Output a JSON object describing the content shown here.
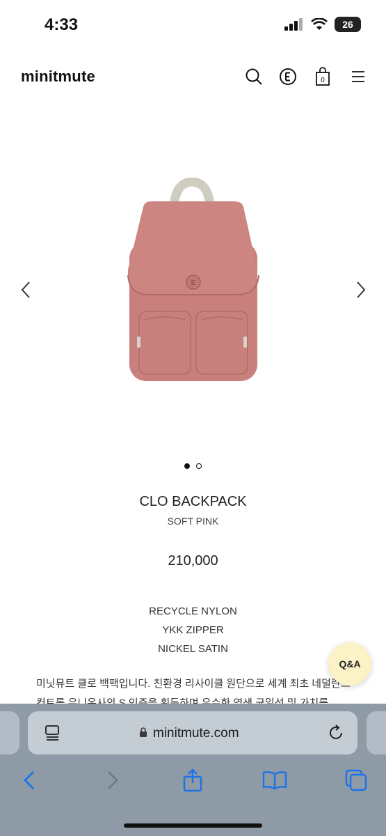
{
  "status_bar": {
    "time": "4:33",
    "battery": "26"
  },
  "header": {
    "logo": "minitmute",
    "icons": [
      "search-icon",
      "e-brand-icon",
      "cart-icon",
      "menu-icon"
    ],
    "cart_count": "0"
  },
  "carousel": {
    "image": "pink-backpack-image",
    "slide_count": 2,
    "active_slide": 1,
    "emblem_letter": "E"
  },
  "product": {
    "name": "CLO BACKPACK",
    "color": "SOFT PINK",
    "price": "210,000",
    "specs": [
      "RECYCLE NYLON",
      "YKK ZIPPER",
      "NICKEL SATIN"
    ],
    "description": "미닛뮤트 클로 백팩입니다. 친환경 리사이클 원단으로 세계 최초 네덜란드 컨트롤 유니온사의 S 인증을 획득하며 우수한 염색 균일성 및 가치를"
  },
  "qa_button": {
    "label": "Q&A"
  },
  "browser": {
    "url": "minitmute.com",
    "toolbar": [
      "back-icon",
      "forward-icon",
      "share-icon",
      "bookmarks-icon",
      "tabs-icon"
    ]
  },
  "colors": {
    "backpack_body": "#c87d79",
    "backpack_handle": "#cfccc0",
    "qa_bg": "#fbf2c6",
    "safari_accent": "#1a73e8",
    "safari_bar": "#8e9aa6"
  }
}
